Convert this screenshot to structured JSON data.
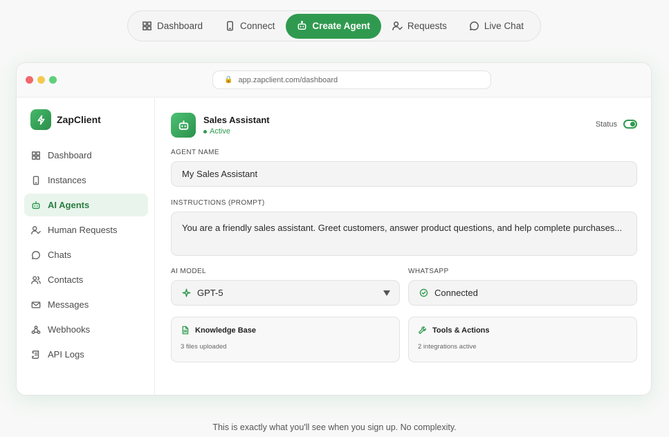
{
  "topnav": {
    "tabs": [
      {
        "label": "Dashboard",
        "icon": "grid-icon"
      },
      {
        "label": "Connect",
        "icon": "phone-icon"
      },
      {
        "label": "Create Agent",
        "icon": "robot-icon",
        "active": true
      },
      {
        "label": "Requests",
        "icon": "user-check-icon"
      },
      {
        "label": "Live Chat",
        "icon": "chat-bubble-icon"
      }
    ]
  },
  "browser": {
    "url": "app.zapclient.com/dashboard"
  },
  "sidebar": {
    "brand": "ZapClient",
    "items": [
      {
        "label": "Dashboard",
        "icon": "grid-icon"
      },
      {
        "label": "Instances",
        "icon": "phone-icon"
      },
      {
        "label": "AI Agents",
        "icon": "robot-icon",
        "active": true
      },
      {
        "label": "Human Requests",
        "icon": "user-check-icon"
      },
      {
        "label": "Chats",
        "icon": "chat-bubble-icon"
      },
      {
        "label": "Contacts",
        "icon": "users-icon"
      },
      {
        "label": "Messages",
        "icon": "mail-icon"
      },
      {
        "label": "Webhooks",
        "icon": "webhook-icon"
      },
      {
        "label": "API Logs",
        "icon": "scroll-icon"
      }
    ]
  },
  "agent": {
    "name": "Sales Assistant",
    "status": "Active",
    "status_label": "Status",
    "toggle_on": true
  },
  "form": {
    "name_label": "AGENT NAME",
    "name_value": "My Sales Assistant",
    "prompt_label": "INSTRUCTIONS (PROMPT)",
    "prompt_value": "You are a friendly sales assistant. Greet customers, answer product questions, and help complete purchases...",
    "model_label": "AI MODEL",
    "model_value": "GPT-5",
    "whatsapp_label": "WHATSAPP",
    "whatsapp_value": "Connected"
  },
  "cards": {
    "knowledge_title": "Knowledge Base",
    "knowledge_sub": "3 files uploaded",
    "tools_title": "Tools & Actions",
    "tools_sub": "2 integrations active"
  },
  "footer": {
    "note": "This is exactly what you'll see when you sign up. No complexity."
  },
  "colors": {
    "accent": "#2f9a4f",
    "active_bg": "#e9f5ec"
  }
}
